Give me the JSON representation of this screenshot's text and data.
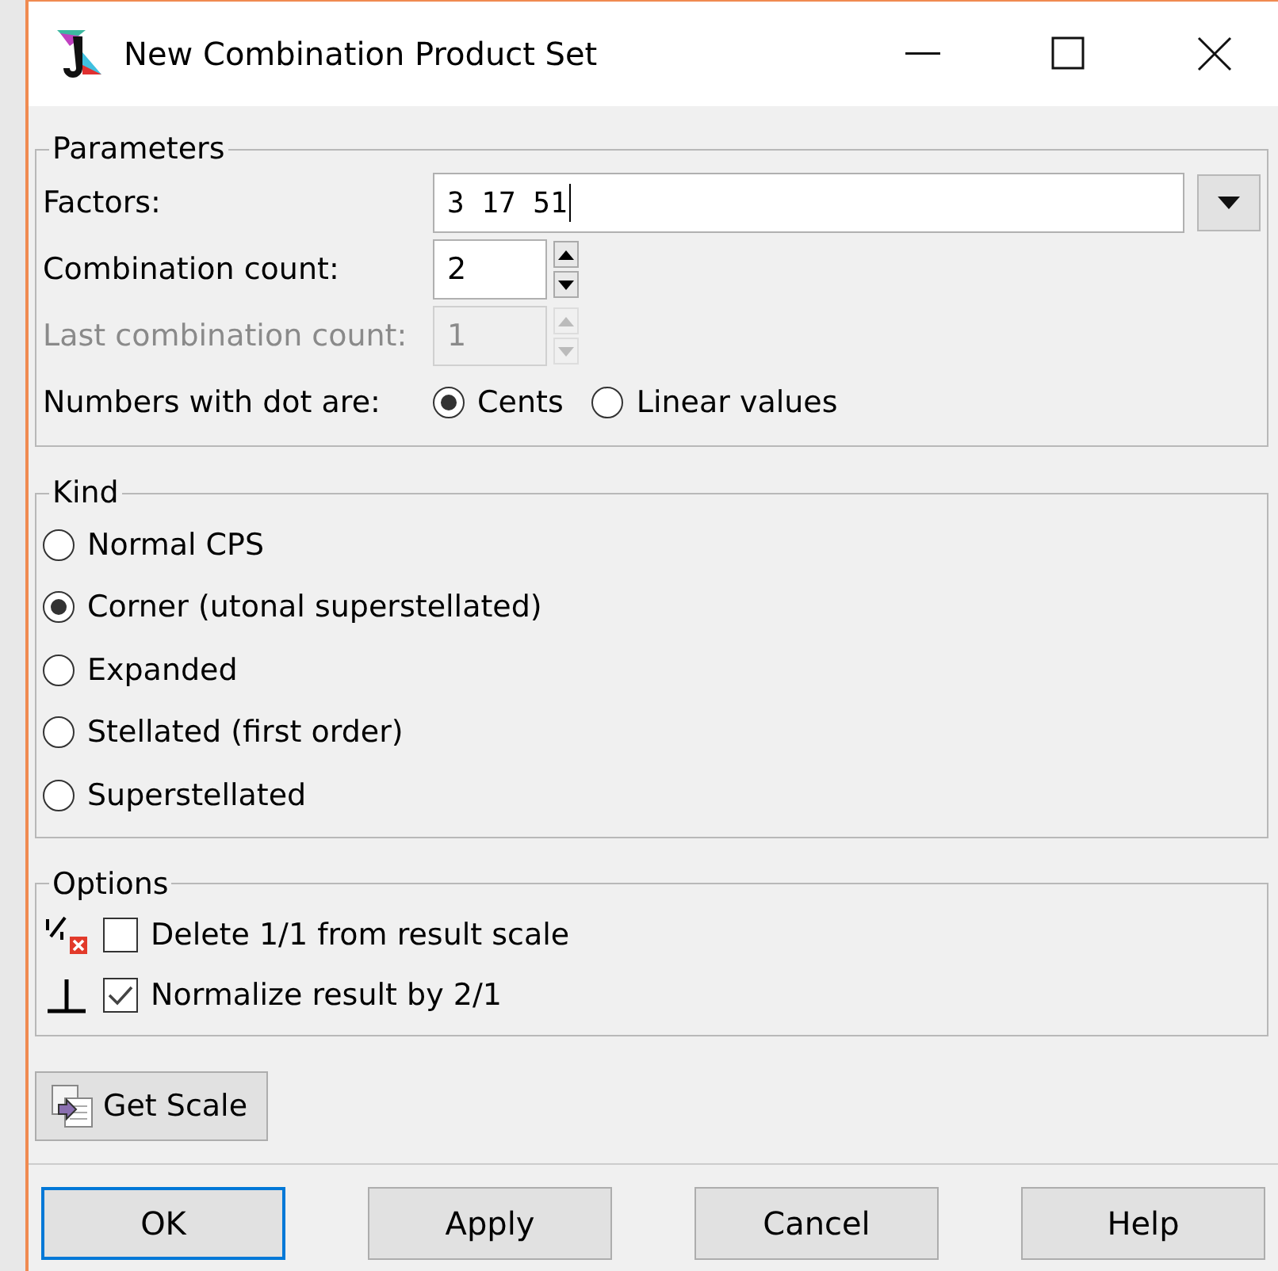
{
  "window": {
    "title": "New Combination Product Set"
  },
  "parameters": {
    "title": "Parameters",
    "factors": {
      "label": "Factors:",
      "value": "3  17  51"
    },
    "combination_count": {
      "label": "Combination count:",
      "value": "2",
      "disabled": false
    },
    "last_combination_count": {
      "label": "Last combination count:",
      "value": "1",
      "disabled": true
    },
    "dot_mode": {
      "label": "Numbers with dot are:",
      "options": [
        {
          "label": "Cents",
          "selected": true
        },
        {
          "label": "Linear values",
          "selected": false
        }
      ]
    }
  },
  "kind": {
    "title": "Kind",
    "options": [
      {
        "label": "Normal CPS",
        "selected": false
      },
      {
        "label": "Corner (utonal superstellated)",
        "selected": true
      },
      {
        "label": "Expanded",
        "selected": false
      },
      {
        "label": "Stellated (first order)",
        "selected": false
      },
      {
        "label": "Superstellated",
        "selected": false
      }
    ]
  },
  "options": {
    "title": "Options",
    "items": [
      {
        "kind": "delete-unison",
        "label": "Delete 1/1 from result scale",
        "checked": false
      },
      {
        "kind": "normalize",
        "label": "Normalize result by 2/1",
        "checked": true
      }
    ]
  },
  "get_scale": {
    "label": "Get Scale"
  },
  "buttons": [
    {
      "label": "OK",
      "default": true
    },
    {
      "label": "Apply",
      "default": false
    },
    {
      "label": "Cancel",
      "default": false
    },
    {
      "label": "Help",
      "default": false
    }
  ]
}
